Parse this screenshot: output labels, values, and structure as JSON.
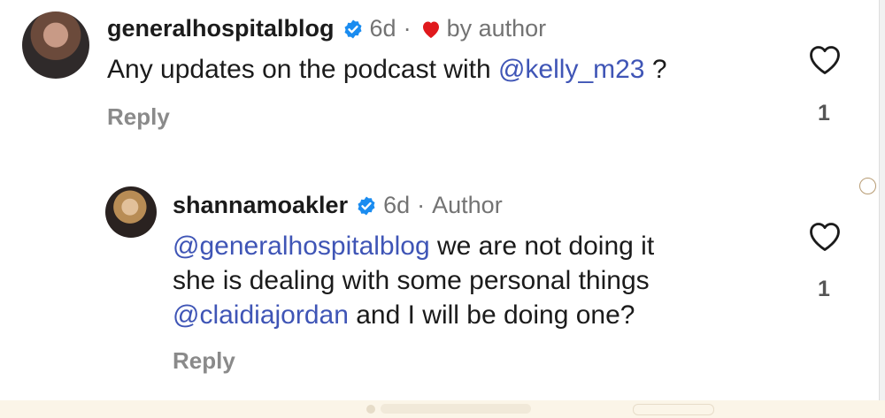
{
  "comments": [
    {
      "username": "generalhospitalblog",
      "time": "6d",
      "separator": "·",
      "liked_label": "by author",
      "text_parts": {
        "before": "Any updates on the podcast with ",
        "mention": "@kelly_m23",
        "after": " ?"
      },
      "reply_label": "Reply",
      "like_count": "1"
    },
    {
      "username": "shannamoakler",
      "time": "6d",
      "separator": "·",
      "author_label": "Author",
      "lines": {
        "line1_mention": "@generalhospitalblog",
        "line1_rest": " we are not doing it",
        "line2": "she is dealing with some personal things",
        "line3_mention": "@claidiajordan",
        "line3_rest": " and I will be doing one?"
      },
      "reply_label": "Reply",
      "like_count": "1"
    }
  ],
  "colors": {
    "mention": "#3f55b6",
    "verified": "#1a8cf0",
    "heart": "#e0191d"
  }
}
